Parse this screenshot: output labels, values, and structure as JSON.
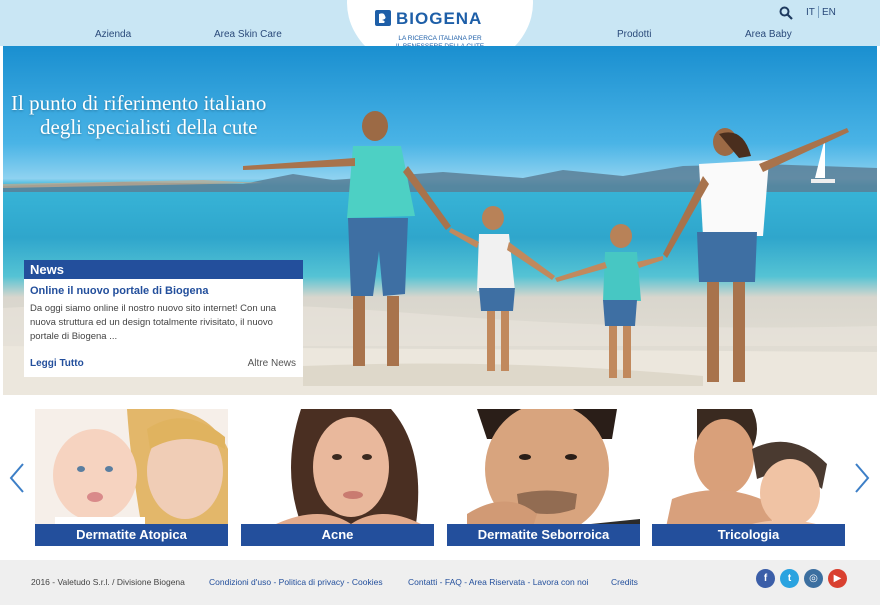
{
  "brand": {
    "name": "BIOGENA",
    "tagline_line1": "LA RICERCA ITALIANA PER",
    "tagline_line2": "IL BENESSERE DELLA CUTE",
    "color_primary": "#234f9c",
    "color_header": "#c9e6f4"
  },
  "nav": {
    "items": [
      "Azienda",
      "Area Skin Care",
      "Prodotti",
      "Area Baby"
    ]
  },
  "languages": [
    "IT",
    "EN"
  ],
  "hero": {
    "title_line1": "Il punto di riferimento italiano",
    "title_line2": "degli specialisti della cute"
  },
  "news": {
    "heading": "News",
    "title": "Online il nuovo portale di Biogena",
    "body": "Da oggi siamo online il nostro nuovo sito internet! Con una nuova struttura ed un design totalmente rivisitato, il nuovo portale di Biogena ...",
    "read_more": "Leggi Tutto",
    "other_news": "Altre News"
  },
  "categories": [
    {
      "label": "Dermatite Atopica"
    },
    {
      "label": "Acne"
    },
    {
      "label": "Dermatite Seborroica"
    },
    {
      "label": "Tricologia"
    }
  ],
  "footer": {
    "copyright": "2016 - Valetudo S.r.l. / Divisione Biogena",
    "legal": "Condizioni d'uso - Politica di privacy - Cookies",
    "links": "Contatti - FAQ - Area Riservata - Lavora con noi",
    "credits": "Credits",
    "social": [
      {
        "icon": "facebook-icon",
        "glyph": "f",
        "color": "#3b5ea8"
      },
      {
        "icon": "twitter-icon",
        "glyph": "t",
        "color": "#2aa3e0"
      },
      {
        "icon": "instagram-icon",
        "glyph": "◎",
        "color": "#3c6fa0"
      },
      {
        "icon": "youtube-icon",
        "glyph": "▶",
        "color": "#d94030"
      }
    ]
  }
}
